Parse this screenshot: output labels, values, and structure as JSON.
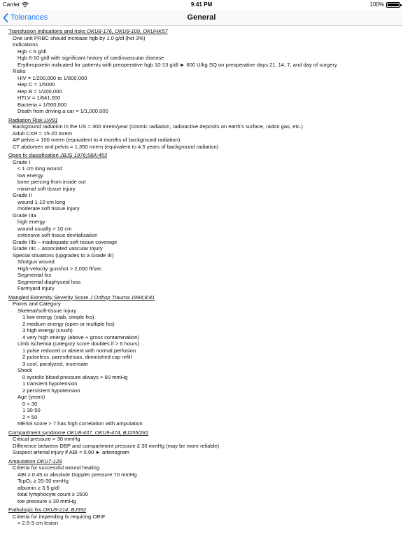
{
  "status_bar": {
    "carrier": "Carrier",
    "time": "9:41 PM",
    "battery": "100%"
  },
  "nav": {
    "back_label": "Tolerances",
    "title": "General"
  },
  "sections": [
    {
      "title": "Transfusion indications and risks",
      "ref": "OKU8-176, OKU9-109, OKUHK57",
      "lines": [
        {
          "level": 1,
          "text": "One unit PRBC should increase hgb by 1.0 g/dl (hct 3%)"
        },
        {
          "level": 1,
          "text": "Indications"
        },
        {
          "level": 2,
          "text": "Hgb < 6 g/dl"
        },
        {
          "level": 2,
          "text": "Hgb 6-10 g/dl with significant history of cardiovascular disease"
        },
        {
          "level": 2,
          "text": "Erythropoietin indicated for patients with preoperative hgb 10-13 g/dl ► 600 U/kg SQ on preoperative days 21, 14, 7, and day of surgery"
        },
        {
          "level": 1,
          "text": "Risks"
        },
        {
          "level": 2,
          "text": "HIV = 1/200,000 to 1/800,000"
        },
        {
          "level": 2,
          "text": "Hep C = 1/5000"
        },
        {
          "level": 2,
          "text": "Hep B = 1/200,000"
        },
        {
          "level": 2,
          "text": "HTLV = 1/641,000"
        },
        {
          "level": 2,
          "text": "Bacteria = 1/500,000"
        },
        {
          "level": 2,
          "text": "Death from driving a car = 1/1,000,000"
        }
      ]
    },
    {
      "title": "Radiation Risk",
      "ref": "LW91",
      "lines": [
        {
          "level": 1,
          "text": "Background radiation in the US = 300 mrem/year (cosmic radiation, radioactive deposits on earth's surface, radon gas, etc.)"
        },
        {
          "level": 1,
          "text": "Adult CXR = 15-20 mrem"
        },
        {
          "level": 1,
          "text": "AP pelvis = 100 mrem (equivalent to 4 months of background radiation)"
        },
        {
          "level": 1,
          "text": "CT abdomen and pelvis = 1,350 mrem (equivalent to 4.5 years of background radiation)"
        }
      ]
    },
    {
      "title": "Open fx classification",
      "ref": "JBJS 1976;58A:453",
      "lines": [
        {
          "level": 1,
          "text": "Grade I"
        },
        {
          "level": 2,
          "text": "< 1 cm long wound"
        },
        {
          "level": 2,
          "text": "low energy"
        },
        {
          "level": 2,
          "text": "bone piercing from inside out"
        },
        {
          "level": 2,
          "text": "minimal soft tissue injury"
        },
        {
          "level": 1,
          "text": "Grade II"
        },
        {
          "level": 2,
          "text": "wound 1-10 cm long"
        },
        {
          "level": 2,
          "text": "moderate soft tissue injury"
        },
        {
          "level": 1,
          "text": "Grade IIIa"
        },
        {
          "level": 2,
          "text": "high energy"
        },
        {
          "level": 2,
          "text": "wound usually > 10 cm"
        },
        {
          "level": 2,
          "text": "extensive soft tissue devitalization"
        },
        {
          "level": 1,
          "text": "Grade IIIb – inadequate soft tissue coverage"
        },
        {
          "level": 1,
          "text": "Grade IIIc – associated vascular injury"
        },
        {
          "level": 1,
          "text": "Special situations (upgrades to a Grade III)"
        },
        {
          "level": 2,
          "text": "Shotgun wound"
        },
        {
          "level": 2,
          "text": "High-velocity gunshot > 2,000 ft/sec"
        },
        {
          "level": 2,
          "text": "Segmental fxs"
        },
        {
          "level": 2,
          "text": "Segmental diaphyseal loss"
        },
        {
          "level": 2,
          "text": "Farmyard injury"
        }
      ]
    },
    {
      "title": "Mangled Extremity Severity Score",
      "ref": "J Orthop Trauma 1994;8:81",
      "lines": [
        {
          "level": 1,
          "text": "Points and Category"
        },
        {
          "level": 2,
          "text": "Skeletal/soft-tissue injury"
        },
        {
          "level": 3,
          "text": "1 low energy (stab, simple fxs)"
        },
        {
          "level": 3,
          "text": "2 medium energy (open or multiple fxs)"
        },
        {
          "level": 3,
          "text": "3 high energy (crush)"
        },
        {
          "level": 3,
          "text": "4 very high energy (above + gross contamination)"
        },
        {
          "level": 2,
          "text": "Limb ischemia (category score doubles if > 6 hours)"
        },
        {
          "level": 3,
          "text": "1 pulse reduced or absent with normal perfusion"
        },
        {
          "level": 3,
          "text": "2 pulseless, paresthesias, diminished cap refill"
        },
        {
          "level": 3,
          "text": "3 cool, paralyzed, insensate"
        },
        {
          "level": 2,
          "text": "Shock"
        },
        {
          "level": 3,
          "text": "0 systolic blood pressure always > 90 mmHg"
        },
        {
          "level": 3,
          "text": "1 transient hypotension"
        },
        {
          "level": 3,
          "text": "2 persistent hypotension"
        },
        {
          "level": 2,
          "text": "Age (years)"
        },
        {
          "level": 3,
          "text": "0 < 30"
        },
        {
          "level": 3,
          "text": "1 30-50"
        },
        {
          "level": 3,
          "text": "2 > 50"
        },
        {
          "level": 2,
          "text": "MESS score > 7 has high correlation with amputation"
        }
      ]
    },
    {
      "title": "Compartment syndrome",
      "ref": "OKU8-437, OKU9-474, BJ255/281",
      "lines": [
        {
          "level": 1,
          "text": "Critical pressure > 30 mmHg"
        },
        {
          "level": 1,
          "text": "Difference between DBP and compartment pressure £ 30 mmHg (may be more reliable)"
        },
        {
          "level": 1,
          "text": "Suspect arterial injury if ABI < 0.90 ► arteriogram"
        }
      ]
    },
    {
      "title": "Amputation",
      "ref": "OKU7-128",
      "lines": [
        {
          "level": 1,
          "text": "Criteria for successful wound healing"
        },
        {
          "level": 2,
          "text": "ABI ≥ 0.45 or absolute Doppler pressure 70 mmHg"
        },
        {
          "level": 2,
          "text": "TcpO₂ ≥ 20-30 mmHg"
        },
        {
          "level": 2,
          "text": "albumin ≥ 3.5 g/dl"
        },
        {
          "level": 2,
          "text": "total lymphocyte count ≥ 1500"
        },
        {
          "level": 2,
          "text": "toe pressure ≥ 30 mmHg"
        }
      ]
    },
    {
      "title": "Pathologic fxs",
      "ref": "OKU9-214, BJ392",
      "lines": [
        {
          "level": 1,
          "text": "Criteria for impending fx requiring ORIF"
        },
        {
          "level": 2,
          "text": "> 2.5-3 cm lesion"
        }
      ]
    }
  ]
}
